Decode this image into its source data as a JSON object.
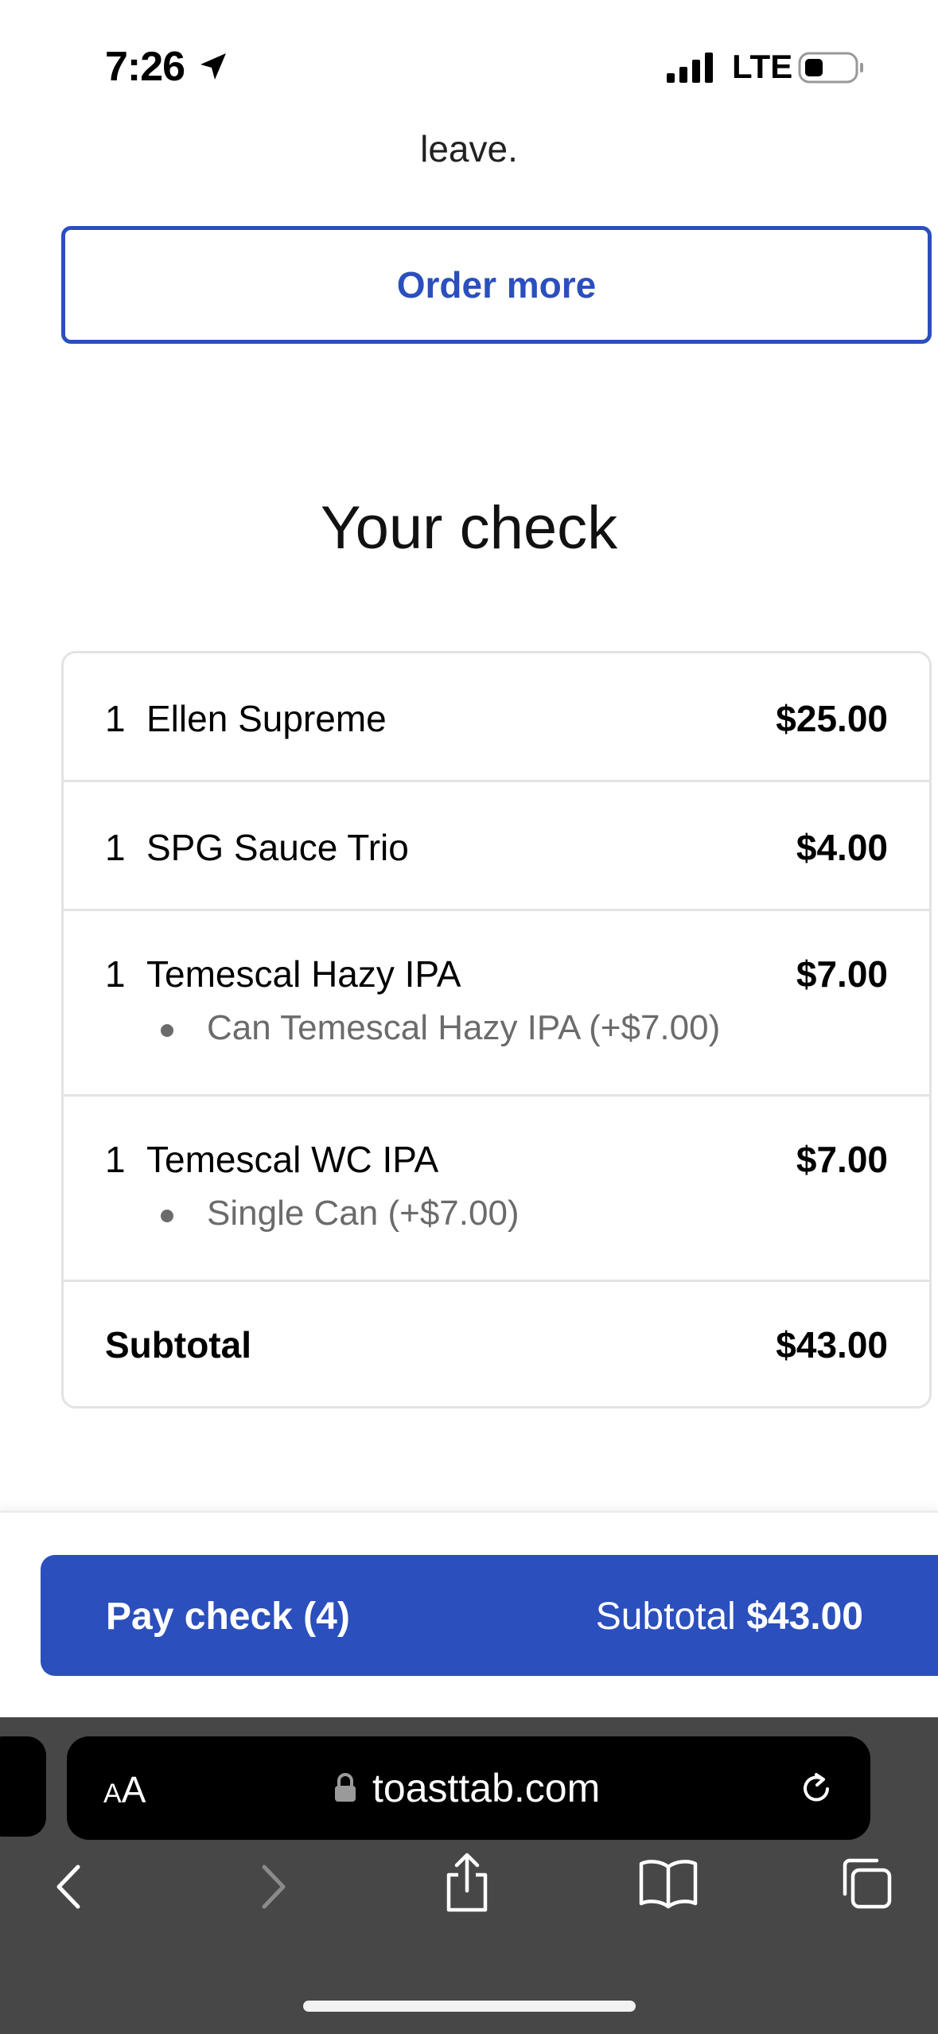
{
  "status_bar": {
    "time": "7:26",
    "network": "LTE",
    "icons": [
      "location-arrow-icon",
      "signal-icon",
      "battery-icon"
    ]
  },
  "header": {
    "leave_text": "leave.",
    "order_more_label": "Order more"
  },
  "check": {
    "title": "Your check",
    "items": [
      {
        "qty": "1",
        "name": "Ellen Supreme",
        "price": "$25.00",
        "modifiers": []
      },
      {
        "qty": "1",
        "name": "SPG Sauce Trio",
        "price": "$4.00",
        "modifiers": []
      },
      {
        "qty": "1",
        "name": "Temescal Hazy IPA",
        "price": "$7.00",
        "modifiers": [
          "Can Temescal Hazy IPA (+$7.00)"
        ]
      },
      {
        "qty": "1",
        "name": "Temescal WC IPA",
        "price": "$7.00",
        "modifiers": [
          "Single Can (+$7.00)"
        ]
      }
    ],
    "subtotal_label": "Subtotal",
    "subtotal_value": "$43.00"
  },
  "pay_bar": {
    "button_label": "Pay check (4)",
    "subtotal_prefix": "Subtotal",
    "subtotal_value": "$43.00"
  },
  "browser": {
    "text_size_label_small": "A",
    "text_size_label_large": "A",
    "url": "toasttab.com",
    "icons": [
      "lock-icon",
      "reload-icon",
      "back-icon",
      "forward-icon",
      "share-icon",
      "bookmarks-icon",
      "tabs-icon"
    ]
  },
  "colors": {
    "accent": "#2b4fbd",
    "browser_bg": "#474747"
  }
}
